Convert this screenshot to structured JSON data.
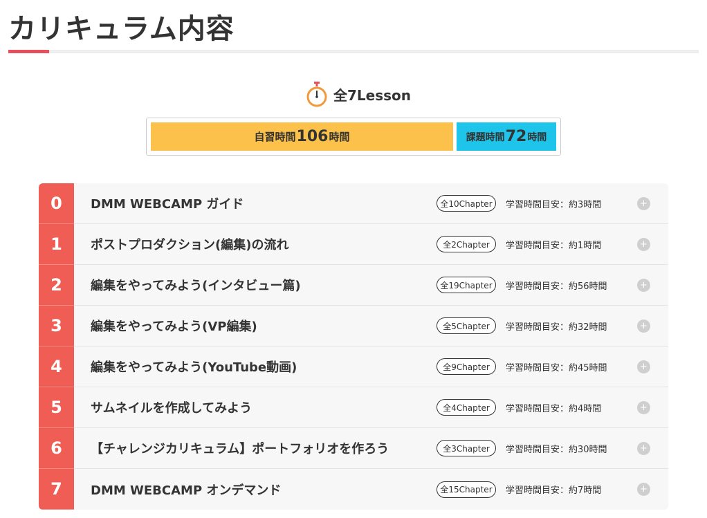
{
  "heading": {
    "title": "カリキュラム内容"
  },
  "summary": {
    "lesson_total": "全7Lesson",
    "self_study_prefix": "自習時間",
    "self_study_hours": "106",
    "self_study_suffix": "時間",
    "assignment_prefix": "課題時間",
    "assignment_hours": "72",
    "assignment_suffix": "時間"
  },
  "colors": {
    "accent_red": "#e6505e",
    "lesson_number_bg": "#f05d55",
    "self_study_bg": "#fcc14a",
    "assignment_bg": "#1ec4ea"
  },
  "lessons": [
    {
      "number": "0",
      "title": "DMM WEBCAMP ガイド",
      "chapters": "全10Chapter",
      "time": "学習時間目安：約3時間"
    },
    {
      "number": "1",
      "title": "ポストプロダクション(編集)の流れ",
      "chapters": "全2Chapter",
      "time": "学習時間目安：約1時間"
    },
    {
      "number": "2",
      "title": "編集をやってみよう(インタビュー篇)",
      "chapters": "全19Chapter",
      "time": "学習時間目安：約56時間"
    },
    {
      "number": "3",
      "title": "編集をやってみよう(VP編集)",
      "chapters": "全5Chapter",
      "time": "学習時間目安：約32時間"
    },
    {
      "number": "4",
      "title": "編集をやってみよう(YouTube動画)",
      "chapters": "全9Chapter",
      "time": "学習時間目安：約45時間"
    },
    {
      "number": "5",
      "title": "サムネイルを作成してみよう",
      "chapters": "全4Chapter",
      "time": "学習時間目安：約4時間"
    },
    {
      "number": "6",
      "title": "【チャレンジカリキュラム】ポートフォリオを作ろう",
      "chapters": "全3Chapter",
      "time": "学習時間目安：約30時間"
    },
    {
      "number": "7",
      "title": "DMM WEBCAMP オンデマンド",
      "chapters": "全15Chapter",
      "time": "学習時間目安：約7時間"
    }
  ],
  "icons": {
    "timer": "stopwatch-icon",
    "expand": "plus-icon",
    "expand_glyph": "+"
  }
}
